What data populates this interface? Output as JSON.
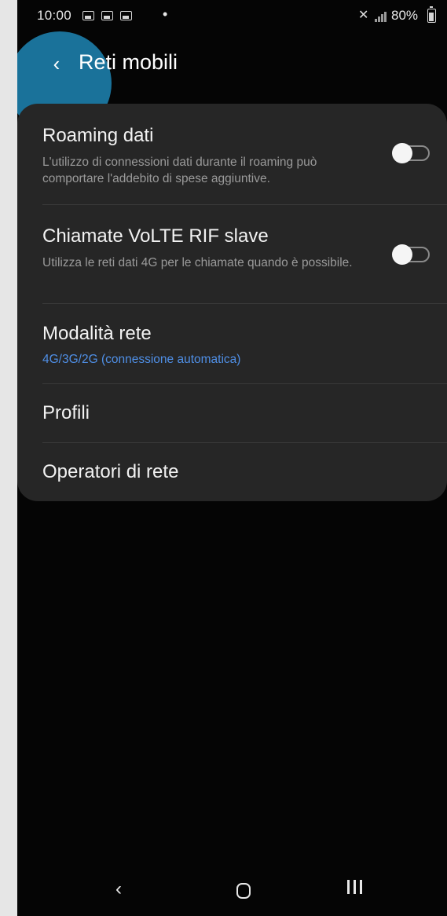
{
  "status_bar": {
    "time": "10:00",
    "dot": "•",
    "battery": "80%",
    "icons": [
      "gallery-notification-icon",
      "message-notification-icon",
      "message-notification-icon",
      "mute-icon",
      "signal-icon",
      "battery-icon"
    ]
  },
  "header": {
    "back_icon": "‹",
    "title": "Reti mobili"
  },
  "settings": {
    "roaming": {
      "title": "Roaming dati",
      "summary": "L'utilizzo di connessioni dati durante il roaming può comportare l'addebito di spese aggiuntive.",
      "enabled": false
    },
    "volte": {
      "title": "Chiamate VoLTE RIF slave",
      "summary": "Utilizza le reti dati 4G per le chiamate quando è possibile.",
      "enabled": false
    },
    "network_mode": {
      "title": "Modalità rete",
      "value": "4G/3G/2G (connessione automatica)"
    },
    "profiles": {
      "title": "Profili"
    },
    "operators": {
      "title": "Operatori di rete"
    }
  },
  "nav_bar": {
    "back": "‹"
  },
  "colors": {
    "background": "#050505",
    "card": "#262626",
    "accent": "#4f8fe6",
    "touch_highlight": "#1e82af"
  }
}
